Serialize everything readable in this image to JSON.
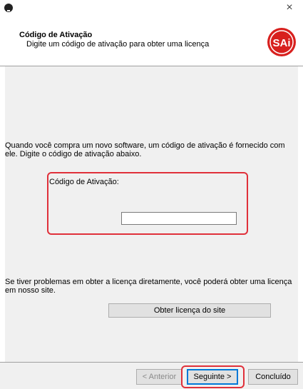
{
  "window": {
    "close_glyph": "×"
  },
  "header": {
    "title": "Código de Ativação",
    "subtitle": "Digite um código de ativação para obter uma licença",
    "logo_text": "SAi",
    "logo_color": "#d8201e"
  },
  "content": {
    "intro": "Quando você compra um novo software, um código de ativação é fornecido com ele.  Digite o código de ativação abaixo.",
    "code_label": "Código de Ativação:",
    "code_value": "",
    "help": "Se tiver problemas em obter a licença diretamente, você poderá obter uma licença em nosso site.",
    "site_button": "Obter licença do site"
  },
  "footer": {
    "back": "< Anterior",
    "next": "Seguinte >",
    "finish": "Concluído"
  },
  "colors": {
    "highlight": "#e0303a",
    "focus": "#0078d7"
  }
}
